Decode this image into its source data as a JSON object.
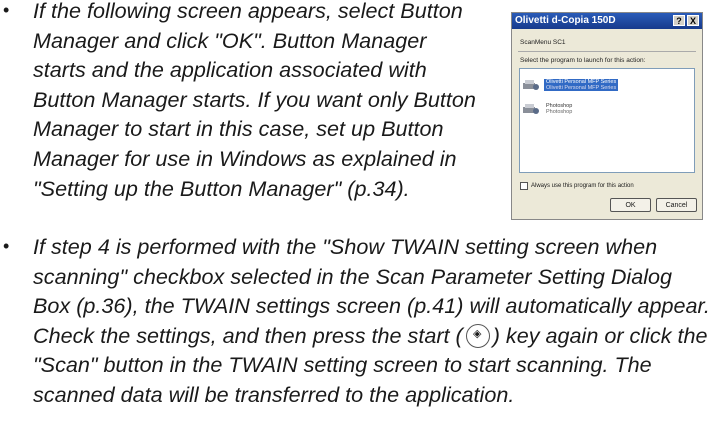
{
  "bullets": [
    {
      "text": "If the following screen appears, select Button Manager and click \"OK\". Button Manager starts and the application associated with Button Manager starts. If you want only Button Manager to start in this case, set up Button Manager for use in Windows as explained in \"Setting up the Button Manager\" (p.34)."
    },
    {
      "text_before": "If step 4 is performed with the \"Show TWAIN setting screen when scanning\" checkbox selected in the Scan Parameter Setting Dialog Box (p.36), the TWAIN settings screen (p.41) will automatically appear. Check the settings, and then press the start (",
      "text_after": ") key again or click the \"Scan\" button in the TWAIN setting screen to start scanning. The scanned data will be transferred to the application."
    }
  ],
  "dialog": {
    "title": "Olivetti d-Copia 150D",
    "help": "?",
    "close": "X",
    "subtitle": "ScanMenu SC1",
    "prompt": "Select the program to launch for this action:",
    "items": [
      {
        "line1": "Olivetti Personal MFP Series",
        "line2": "Olivetti Personal MFP Series",
        "icon": "scanner-app-icon",
        "selected": true
      },
      {
        "line1": "Photoshop",
        "line2": "Photoshop",
        "icon": "photoshop-app-icon",
        "selected": false
      }
    ],
    "checkbox_label": "Always use this program for this action",
    "ok": "OK",
    "cancel": "Cancel"
  },
  "colors": {
    "title_bar": "#1f4aa8",
    "selection": "#316ac5"
  }
}
